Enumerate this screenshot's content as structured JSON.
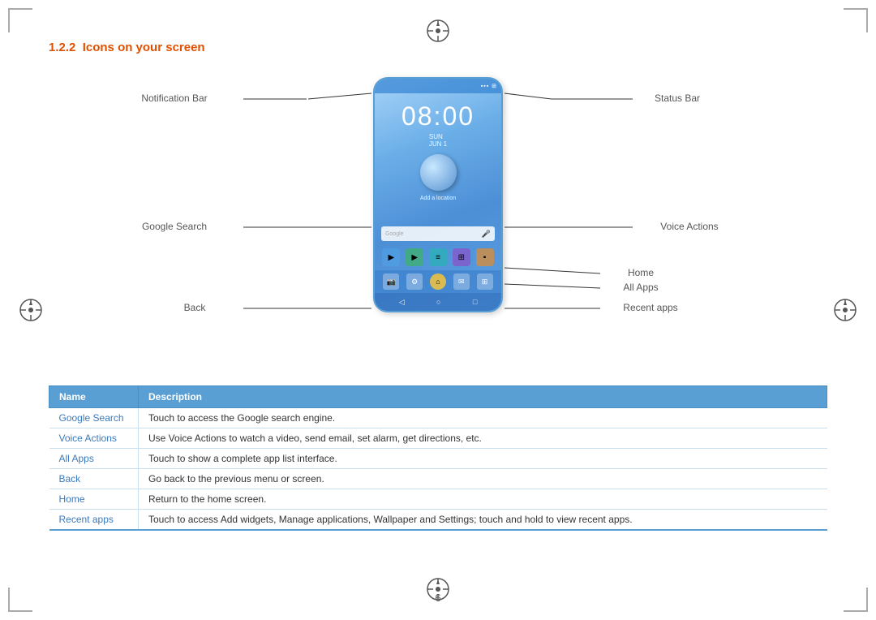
{
  "page": {
    "number": "6",
    "section": {
      "number": "1.2.2",
      "title": "Icons on your screen"
    }
  },
  "diagram": {
    "labels": {
      "notification_bar": "Notification Bar",
      "status_bar": "Status Bar",
      "google_search": "Google Search",
      "voice_actions": "Voice Actions",
      "home": "Home",
      "all_apps": "All Apps",
      "back": "Back",
      "recent_apps": "Recent apps"
    },
    "phone": {
      "time": "08:00",
      "date_line1": "SUN",
      "date_line2": "JUN 1",
      "location_text": "Add a location",
      "search_placeholder": "Google"
    }
  },
  "table": {
    "headers": [
      "Name",
      "Description"
    ],
    "rows": [
      {
        "name": "Google Search",
        "description": "Touch to access the Google search engine."
      },
      {
        "name": "Voice Actions",
        "description": "Use Voice Actions to watch a video, send email, set alarm, get directions, etc."
      },
      {
        "name": "All Apps",
        "description": "Touch to show a complete app list interface."
      },
      {
        "name": "Back",
        "description": "Go back to the previous menu or screen."
      },
      {
        "name": "Home",
        "description": "Return to the home screen."
      },
      {
        "name": "Recent apps",
        "description": "Touch to access Add widgets, Manage applications, Wallpaper and Settings; touch and hold to view recent apps."
      }
    ]
  }
}
